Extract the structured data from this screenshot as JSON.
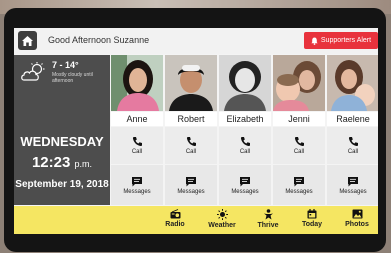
{
  "header": {
    "greeting": "Good Afternoon Suzanne",
    "alert_label": "Supporters Alert"
  },
  "weather": {
    "temp": "7 - 14°",
    "description": "Mostly cloudy until afternoon"
  },
  "clock": {
    "day": "WEDNESDAY",
    "time": "12:23",
    "ampm": "p.m.",
    "date": "September 19, 2018"
  },
  "contacts": [
    {
      "name": "Anne",
      "call_label": "Call",
      "messages_label": "Messages"
    },
    {
      "name": "Robert",
      "call_label": "Call",
      "messages_label": "Messages"
    },
    {
      "name": "Elizabeth",
      "call_label": "Call",
      "messages_label": "Messages"
    },
    {
      "name": "Jenni",
      "call_label": "Call",
      "messages_label": "Messages"
    },
    {
      "name": "Raelene",
      "call_label": "Call",
      "messages_label": "Messages"
    }
  ],
  "nav": [
    {
      "label": "Radio",
      "icon": "radio-icon"
    },
    {
      "label": "Weather",
      "icon": "sun-icon"
    },
    {
      "label": "Thrive",
      "icon": "thrive-icon"
    },
    {
      "label": "Today",
      "icon": "calendar-icon"
    },
    {
      "label": "Photos",
      "icon": "photo-icon"
    }
  ],
  "colors": {
    "alert": "#e8323c",
    "bottom_bar": "#f5e662",
    "panel": "#4d4d4d"
  }
}
